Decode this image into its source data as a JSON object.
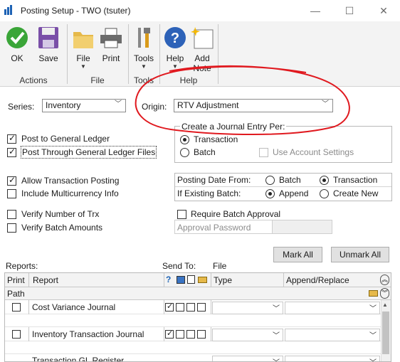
{
  "window": {
    "title": "Posting Setup  -  TWO (tsuter)",
    "minimize": "—",
    "maximize": "☐",
    "close": "✕"
  },
  "ribbon": {
    "buttons": {
      "ok": "OK",
      "save": "Save",
      "file": "File",
      "print": "Print",
      "tools": "Tools",
      "help": "Help",
      "add_note": "Add Note"
    },
    "arrow": "▼",
    "groups": {
      "actions": "Actions",
      "file": "File",
      "tools": "Tools",
      "help": "Help"
    }
  },
  "form": {
    "series_label": "Series:",
    "series_value": "Inventory",
    "origin_label": "Origin:",
    "origin_value": "RTV Adjustment",
    "post_gl": "Post to General Ledger",
    "post_through_gl": "Post Through General Ledger Files",
    "create_je_title": "Create a Journal Entry Per:",
    "je_transaction": "Transaction",
    "je_batch": "Batch",
    "use_account_settings": "Use Account Settings",
    "allow_tx_posting": "Allow Transaction Posting",
    "include_multicurrency": "Include Multicurrency Info",
    "posting_date_from": "Posting Date From:",
    "pdf_batch": "Batch",
    "pdf_transaction": "Transaction",
    "if_existing_batch": "If Existing Batch:",
    "append": "Append",
    "create_new": "Create New",
    "verify_trx": "Verify Number of Trx",
    "verify_batch": "Verify Batch Amounts",
    "require_batch_approval": "Require Batch Approval",
    "approval_password": "Approval Password",
    "mark_all": "Mark All",
    "unmark_all": "Unmark All"
  },
  "reports": {
    "label": "Reports:",
    "send_to": "Send To:",
    "file": "File",
    "headers": {
      "print": "Print",
      "report": "Report",
      "help_q": "?",
      "type": "Type",
      "append_replace": "Append/Replace",
      "path": "Path"
    },
    "rows": [
      {
        "name": "Cost Variance Journal"
      },
      {
        "name": "Inventory Transaction Journal"
      },
      {
        "name": "Transaction GL Register"
      }
    ]
  },
  "colors": {
    "accent": "#1e63b5",
    "annotation": "#e0191f"
  }
}
